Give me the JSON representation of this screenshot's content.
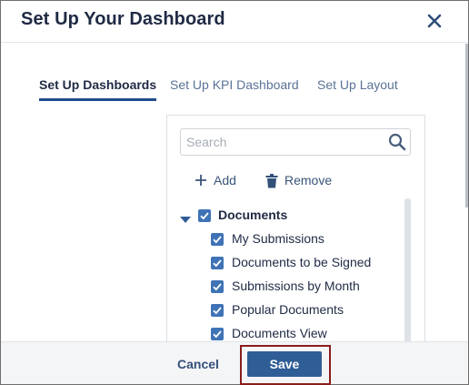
{
  "dialog": {
    "title": "Set Up Your Dashboard",
    "close_icon": "close-icon"
  },
  "tabs": [
    {
      "label": "Set Up Dashboards",
      "active": true
    },
    {
      "label": "Set Up KPI Dashboard",
      "active": false
    },
    {
      "label": "Set Up Layout",
      "active": false
    }
  ],
  "search": {
    "placeholder": "Search",
    "value": "",
    "icon": "search-icon"
  },
  "actions": {
    "add_label": "Add",
    "add_icon": "plus-icon",
    "remove_label": "Remove",
    "remove_icon": "trash-icon"
  },
  "tree": {
    "root": {
      "label": "Documents",
      "checked": true,
      "expanded": true
    },
    "children": [
      {
        "label": "My Submissions",
        "checked": true
      },
      {
        "label": "Documents to be Signed",
        "checked": true
      },
      {
        "label": "Submissions by Month",
        "checked": true
      },
      {
        "label": "Popular Documents",
        "checked": true
      },
      {
        "label": "Documents View",
        "checked": true
      }
    ]
  },
  "footer": {
    "cancel_label": "Cancel",
    "save_label": "Save"
  },
  "colors": {
    "accent": "#2f5d96",
    "checkbox": "#3f73b6",
    "highlight": "#8b1c1c",
    "text": "#1f2a44"
  }
}
